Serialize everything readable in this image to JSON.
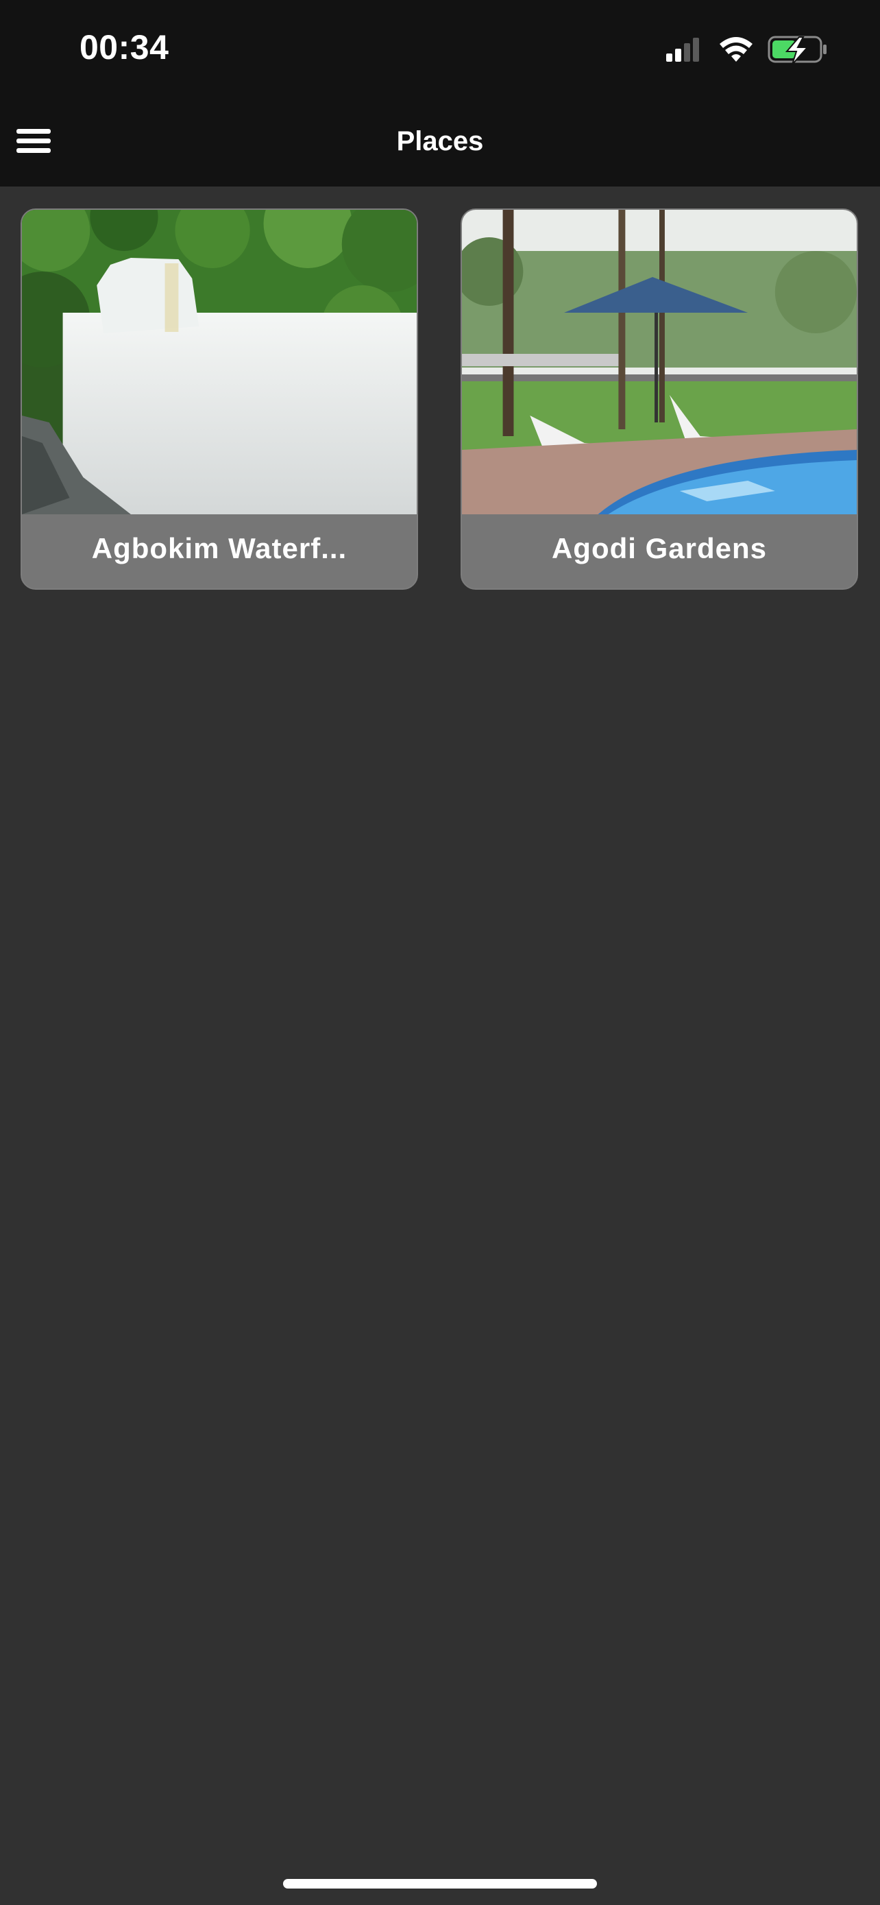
{
  "status_bar": {
    "time": "00:34",
    "icons": [
      "cellular-signal-icon",
      "wifi-icon",
      "battery-charging-icon"
    ],
    "battery_color": "#4cd964"
  },
  "header": {
    "menu_icon": "hamburger-menu-icon",
    "title": "Places"
  },
  "places": [
    {
      "label": "Agbokim Waterf...",
      "image": "waterfall-photo"
    },
    {
      "label": "Agodi Gardens",
      "image": "garden-pool-photo"
    }
  ],
  "colors": {
    "background": "#313131",
    "bars": "#121212",
    "card_footer": "#767676",
    "text": "#ffffff"
  }
}
